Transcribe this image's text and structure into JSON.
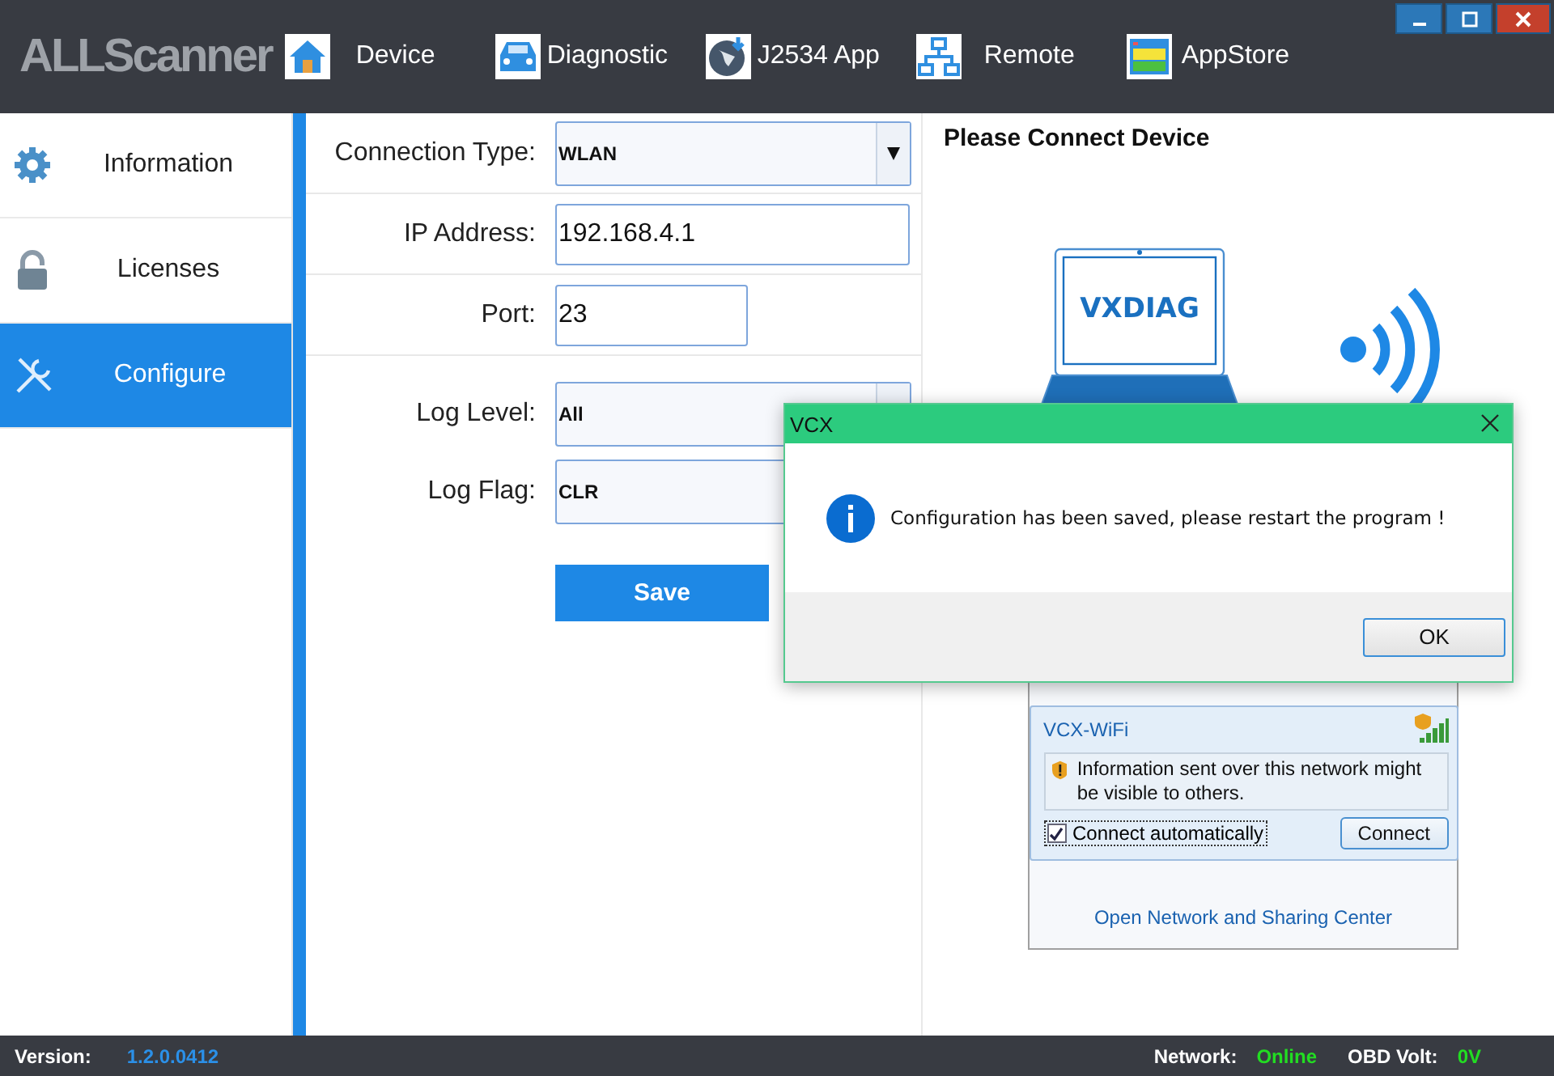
{
  "header": {
    "logo": "ALLScanner",
    "nav": [
      {
        "label": "Device",
        "kind": "home"
      },
      {
        "label": "Diagnostic",
        "kind": "car"
      },
      {
        "label": "J2534 App",
        "kind": "globe"
      },
      {
        "label": "Remote",
        "kind": "network"
      },
      {
        "label": "AppStore",
        "kind": "store"
      }
    ]
  },
  "sidebar": {
    "items": [
      {
        "label": "Information",
        "kind": "gear",
        "selected": false
      },
      {
        "label": "Licenses",
        "kind": "lock",
        "selected": false
      },
      {
        "label": "Configure",
        "kind": "tools",
        "selected": true
      }
    ]
  },
  "form": {
    "fields": [
      {
        "label": "Connection Type:",
        "kind": "select",
        "value": "WLAN"
      },
      {
        "label": "IP Address:",
        "kind": "input",
        "value": "192.168.4.1"
      },
      {
        "label": "Port:",
        "kind": "short",
        "value": "23"
      },
      {
        "label": "Log Level:",
        "kind": "select",
        "value": "All"
      },
      {
        "label": "Log Flag:",
        "kind": "select",
        "value": "CLR"
      }
    ],
    "save_button": "Save"
  },
  "device_panel": {
    "title": "Please Connect Device",
    "device_label": "VXDIAG",
    "wifi_popup": {
      "network": "VCX-WiFi",
      "warning": "Information sent over this network might be visible to others.",
      "auto_connect": {
        "label": "Connect automatically",
        "checked": true
      },
      "connect_button": "Connect",
      "link": "Open Network and Sharing Center"
    }
  },
  "dialog": {
    "title": "VCX",
    "message": "Configuration has been saved, please restart the program !",
    "ok_button": "OK"
  },
  "status_bar": {
    "version_label": "Version:",
    "version": "1.2.0.0412",
    "network_label": "Network:",
    "network": "Online",
    "volt_label": "OBD Volt:",
    "volt": "0V"
  }
}
